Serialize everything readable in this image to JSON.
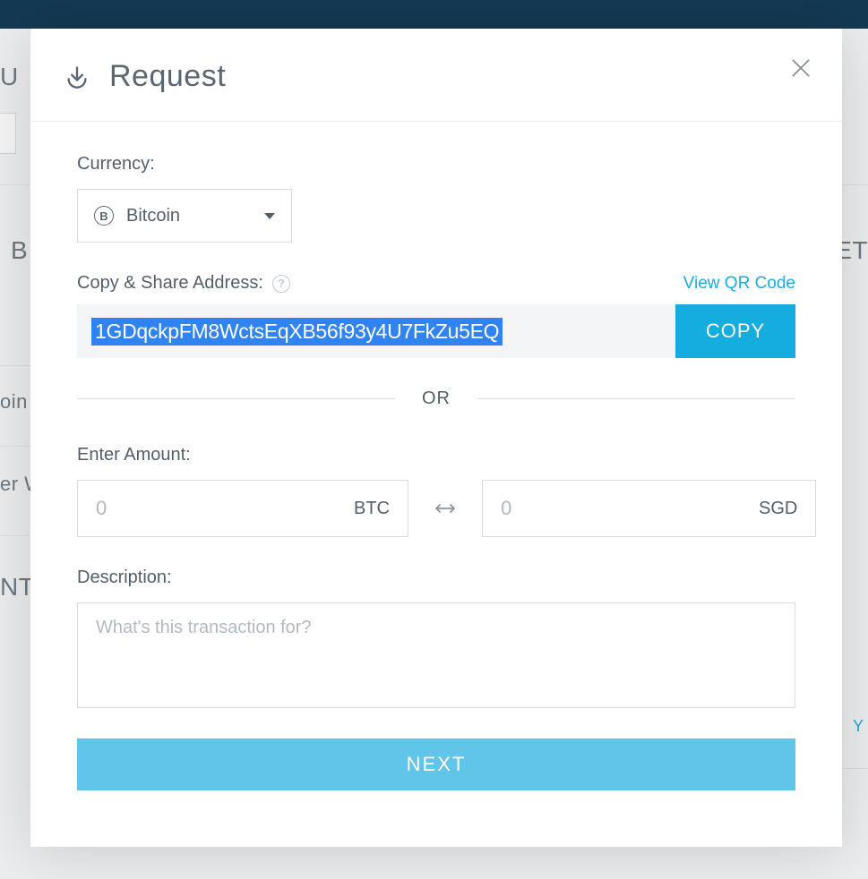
{
  "modal": {
    "title": "Request",
    "currency_label": "Currency:",
    "currency_selected": "Bitcoin",
    "address_label": "Copy & Share Address:",
    "view_qr_label": "View QR Code",
    "address_value": "1GDqckpFM8WctsEqXB56f93y4U7FkZu5EQ",
    "copy_label": "COPY",
    "or_label": "OR",
    "amount_label": "Enter Amount:",
    "amount_btc_placeholder": "0",
    "amount_btc_unit": "BTC",
    "amount_fiat_placeholder": "0",
    "amount_fiat_unit": "SGD",
    "description_label": "Description:",
    "description_placeholder": "What's this transaction for?",
    "next_label": "NEXT"
  },
  "bg": {
    "t1": "U",
    "t2": "B",
    "t3": "oin",
    "t4": "er W",
    "t5": "NT",
    "t6": "ET",
    "ychar": "Y"
  }
}
